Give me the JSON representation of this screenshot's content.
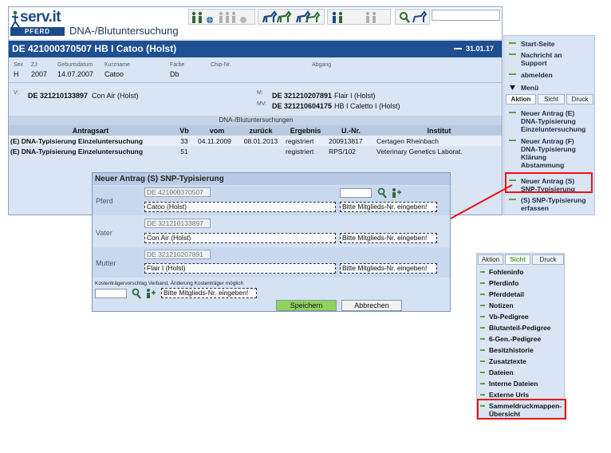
{
  "app": {
    "brand": "serv.it",
    "brand_sub": "PFERD",
    "page_title": "DNA-/Blutuntersuchung"
  },
  "horse": {
    "header": "DE 421000370507  HB I Catoo (Holst)",
    "date": "31.01.17",
    "labels": {
      "sex": "Sex",
      "zj": "ZJ",
      "birth": "Geburtsdatum",
      "short": "Kurzname",
      "color": "Farbe",
      "chip": "Chip-Nr.",
      "exit": "Abgang"
    },
    "values": {
      "sex": "H",
      "zj": "2007",
      "birth": "14.07.2007",
      "short": "Catoo",
      "color": "Db"
    },
    "sire_label": "V:",
    "sire_id": "DE 321210133897",
    "sire_name": "Con Air (Holst)",
    "dam_label": "M:",
    "dam_id": "DE 321210207891",
    "dam_name": "Flair I (Holst)",
    "damsire_label": "MV:",
    "damsire_id": "DE 321210604175",
    "damsire_name": "HB I Caletto I (Holst)"
  },
  "dna_table": {
    "caption": "DNA-/Blutuntersuchungen",
    "columns": [
      "Antragsart",
      "Vb",
      "vom",
      "zurück",
      "Ergebnis",
      "U.-Nr.",
      "Institut"
    ],
    "rows": [
      [
        "(E) DNA-Typisierung Einzeluntersuchung",
        "33",
        "04.11.2009",
        "08.01.2013",
        "registriert",
        "200913817",
        "Certagen Rheinbach"
      ],
      [
        "(E) DNA-Typisierung Einzeluntersuchung",
        "51",
        "",
        "",
        "registriert",
        "RPS/102",
        "Veterinary Genetics Laborat."
      ]
    ]
  },
  "menu": {
    "start": "Start-Seite",
    "message_1": "Nachricht an",
    "message_2": "Support",
    "logout": "abmelden",
    "menu_label": "Menü",
    "tabs": [
      "Aktion",
      "Sicht",
      "Druck"
    ],
    "items": [
      [
        "Neuer Antrag (E)",
        "DNA-Typisierung",
        "Einzeluntersuchung"
      ],
      [
        "Neuer Antrag (F)",
        "DNA-Typisierung",
        "Klärung",
        "Abstammung"
      ],
      [
        "Neuer Antrag (S)",
        "SNP-Typisierung"
      ],
      [
        "(S) SNP-Typisierung",
        "erfassen"
      ]
    ]
  },
  "dialog": {
    "title": "Neuer Antrag (S) SNP-Typisierung",
    "rows": [
      {
        "label": "Pferd",
        "id": "DE 421000370507",
        "name": "Catoo (Holst)",
        "member_placeholder": "Bitte Mitglieds-Nr. eingeben!"
      },
      {
        "label": "Vater",
        "id": "DE 321210133897",
        "name": "Con Air (Holst)",
        "member_placeholder": "Bitte Mitglieds-Nr. eingeben!"
      },
      {
        "label": "Mutter",
        "id": "DE 321210207891",
        "name": "Flair I (Holst)",
        "member_placeholder": "Bitte Mitglieds-Nr. eingeben!"
      }
    ],
    "cost_note": "Kostenträgervorschlag Verband, Änderung Kostenträger möglich",
    "cost_placeholder": "Bitte Mitglieds-Nr. eingeben!",
    "save": "Speichern",
    "cancel": "Abbrechen"
  },
  "sicht_panel": {
    "tabs": [
      "Aktion",
      "Sicht",
      "Druck"
    ],
    "items": [
      "Fohleninfo",
      "Pferdinfo",
      "Pferddetail",
      "Notizen",
      "Vb-Pedigree",
      "Blutanteil-Pedigree",
      "6-Gen.-Pedigree",
      "Besitzhistorie",
      "Zusatztexte",
      "Dateien",
      "Interne Dateien",
      "Externe Urls"
    ],
    "highlight_1": "Sammeldruckmappen-",
    "highlight_2": "Übersicht"
  },
  "colors": {
    "header_blue": "#1e4f91",
    "accent_green": "#5aa23c",
    "highlight_red": "#e11111",
    "save_green": "#8fd25c"
  }
}
